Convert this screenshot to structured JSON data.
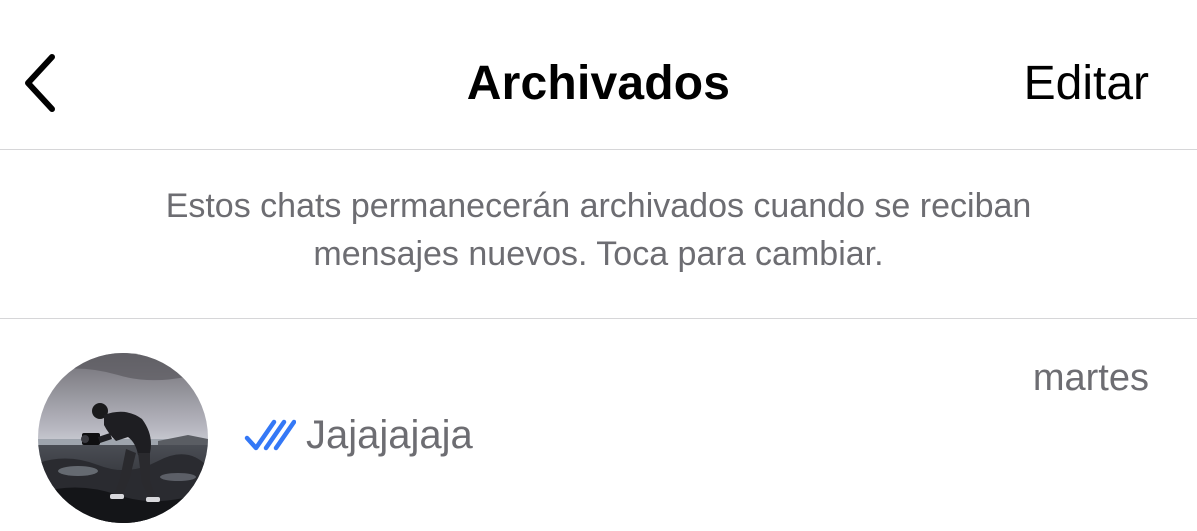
{
  "header": {
    "title": "Archivados",
    "edit_label": "Editar",
    "back_icon": "chevron-left-icon"
  },
  "banner": {
    "line1": "Estos chats permanecerán archivados cuando se reciban",
    "line2": "mensajes nuevos. Toca para cambiar."
  },
  "chats": [
    {
      "time": "martes",
      "last_message": "Jajajajaja",
      "status_icon": "double-check-icon",
      "status_color": "#3478f6",
      "avatar_icon": "contact-photo"
    }
  ],
  "colors": {
    "primary_text": "#000000",
    "secondary_text": "#6d6d72",
    "separator": "#d6d6d8",
    "read_receipt": "#3478f6"
  }
}
